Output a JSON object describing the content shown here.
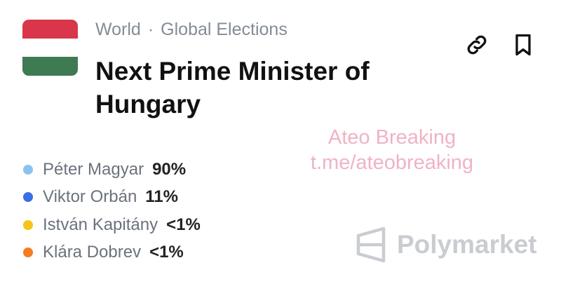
{
  "flag": {
    "icon": "hungary-flag-icon",
    "colors": [
      "#d9364b",
      "#ffffff",
      "#3e7a52"
    ]
  },
  "breadcrumb": {
    "category": "World",
    "separator": "·",
    "subcategory": "Global Elections"
  },
  "market": {
    "title": "Next Prime Minister of Hungary"
  },
  "actions": {
    "link_icon": "link-icon",
    "bookmark_icon": "bookmark-icon"
  },
  "outcomes": [
    {
      "name": "Péter Magyar",
      "percent": "90%",
      "color": "#8dc2f0"
    },
    {
      "name": "Viktor Orbán",
      "percent": "11%",
      "color": "#3a6ee6"
    },
    {
      "name": "István Kapitány",
      "percent": "<1%",
      "color": "#f6c318"
    },
    {
      "name": "Klára Dobrev",
      "percent": "<1%",
      "color": "#f57c1f"
    }
  ],
  "watermark": {
    "line1": "Ateo Breaking",
    "line2": "t.me/ateobreaking"
  },
  "brand": {
    "logo_icon": "polymarket-logo-icon",
    "name": "Polymarket"
  }
}
